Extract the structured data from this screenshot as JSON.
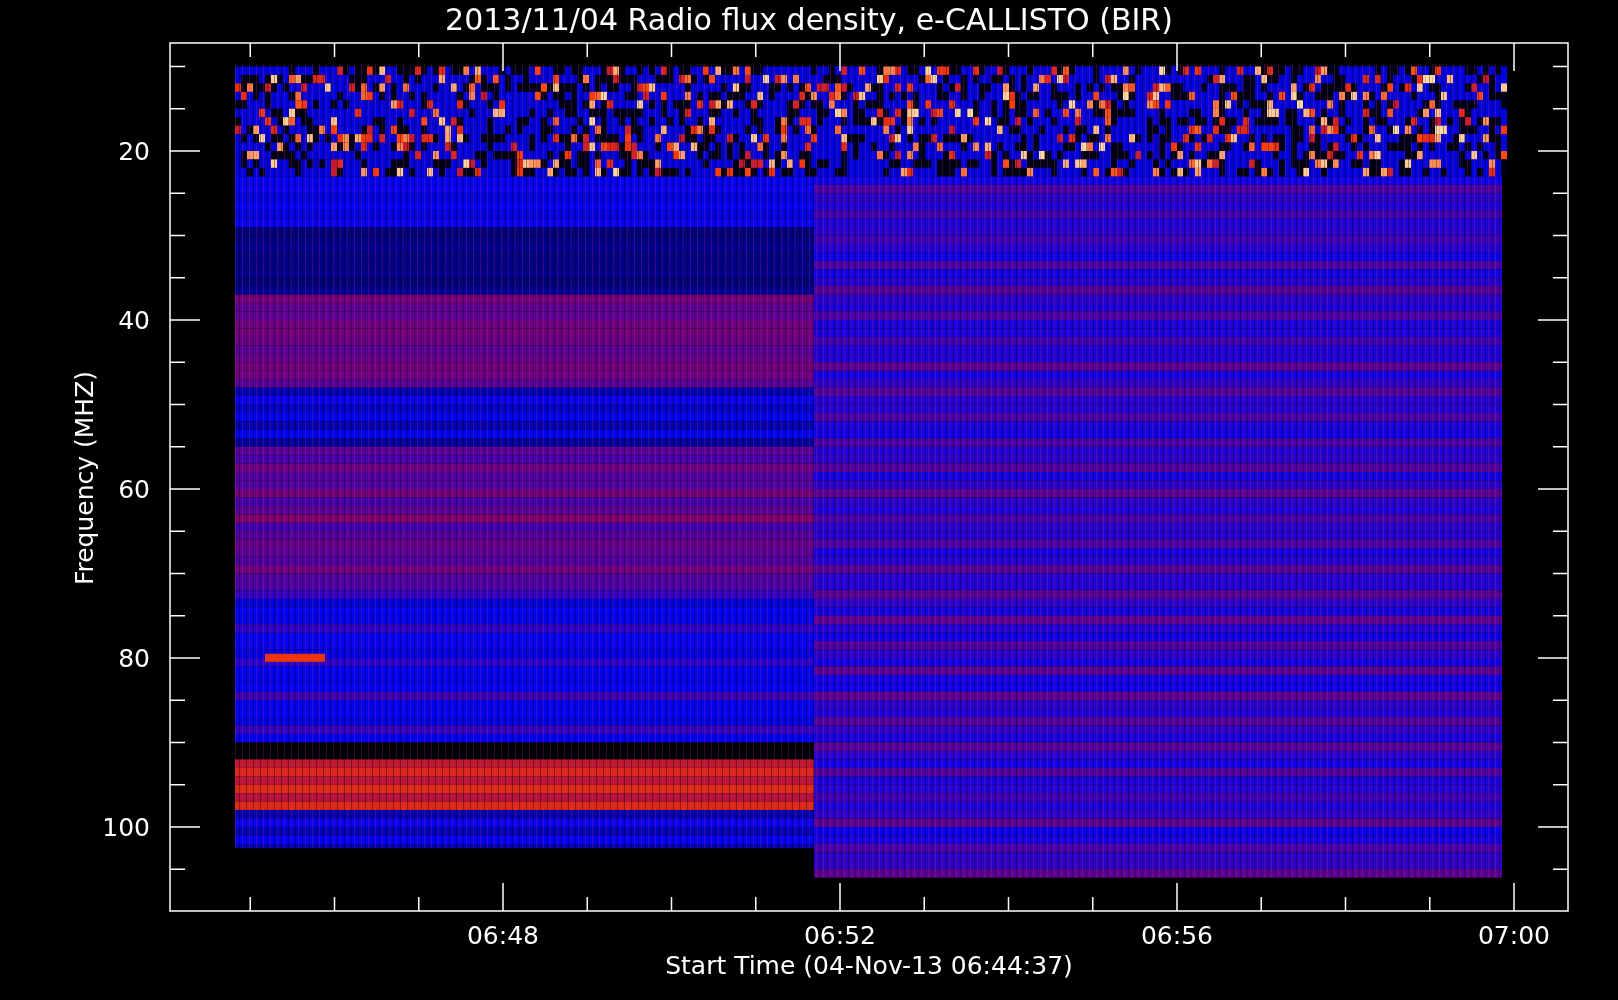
{
  "title": "2013/11/04  Radio flux density, e-CALLISTO (BIR)",
  "y_axis": {
    "label": "Frequency (MHZ)",
    "ticks": [
      "20",
      "40",
      "60",
      "80",
      "100"
    ]
  },
  "x_axis": {
    "label": "Start Time (04-Nov-13 06:44:37)",
    "ticks": [
      "06:48",
      "06:52",
      "06:56",
      "07:00"
    ]
  }
}
